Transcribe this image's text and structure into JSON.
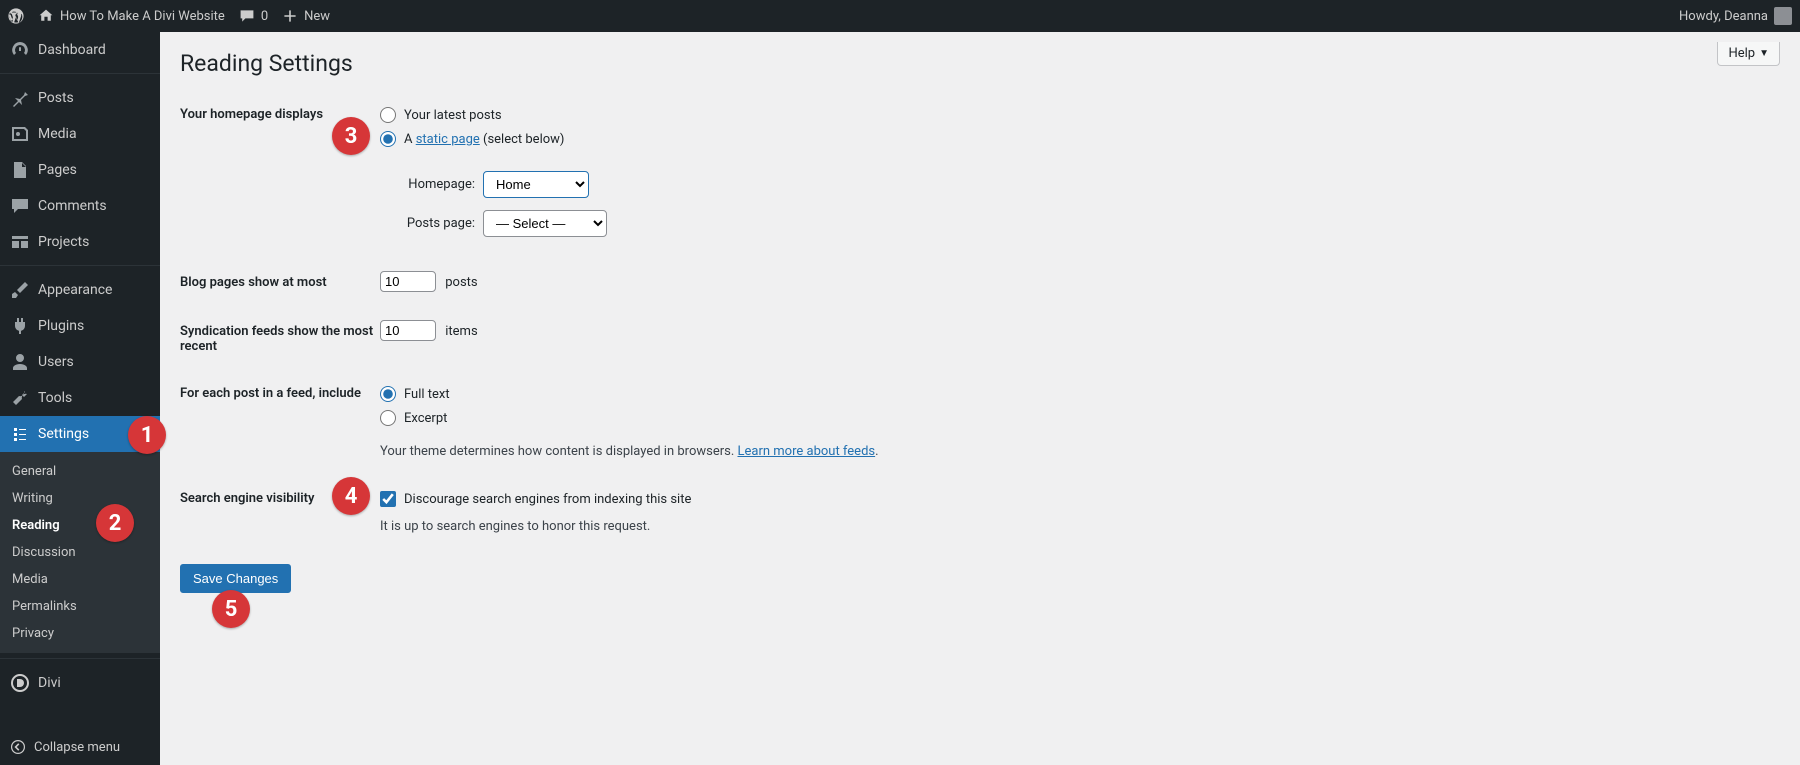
{
  "adminbar": {
    "site_title": "How To Make A Divi Website",
    "comments_count": "0",
    "new_label": "New",
    "howdy": "Howdy, Deanna"
  },
  "sidebar": {
    "items": [
      {
        "label": "Dashboard",
        "icon": "dashboard"
      },
      {
        "label": "Posts",
        "icon": "pin"
      },
      {
        "label": "Media",
        "icon": "media"
      },
      {
        "label": "Pages",
        "icon": "page"
      },
      {
        "label": "Comments",
        "icon": "comment"
      },
      {
        "label": "Projects",
        "icon": "projects"
      },
      {
        "label": "Appearance",
        "icon": "brush"
      },
      {
        "label": "Plugins",
        "icon": "plug"
      },
      {
        "label": "Users",
        "icon": "user"
      },
      {
        "label": "Tools",
        "icon": "wrench"
      },
      {
        "label": "Settings",
        "icon": "settings",
        "active": true
      },
      {
        "label": "Divi",
        "icon": "divi"
      }
    ],
    "submenu": [
      "General",
      "Writing",
      "Reading",
      "Discussion",
      "Media",
      "Permalinks",
      "Privacy"
    ],
    "submenu_active": "Reading",
    "collapse": "Collapse menu"
  },
  "page": {
    "help": "Help",
    "title": "Reading Settings",
    "labels": {
      "homepage_displays": "Your homepage displays",
      "latest_posts": "Your latest posts",
      "static_page_prefix": "A ",
      "static_page_link": "static page",
      "static_page_suffix": " (select below)",
      "homepage_label": "Homepage:",
      "posts_page_label": "Posts page:",
      "blog_pages": "Blog pages show at most",
      "posts_suffix": "posts",
      "syndication": "Syndication feeds show the most recent",
      "items_suffix": "items",
      "feed_include": "For each post in a feed, include",
      "full_text": "Full text",
      "excerpt": "Excerpt",
      "feed_hint_prefix": "Your theme determines how content is displayed in browsers. ",
      "feed_hint_link": "Learn more about feeds",
      "search_visibility": "Search engine visibility",
      "discourage": "Discourage search engines from indexing this site",
      "discourage_note": "It is up to search engines to honor this request.",
      "save": "Save Changes"
    },
    "values": {
      "homepage_select": "Home",
      "posts_page_select": "— Select —",
      "blog_pages_count": "10",
      "syndication_count": "10"
    }
  },
  "badges": [
    "1",
    "2",
    "3",
    "4",
    "5"
  ]
}
